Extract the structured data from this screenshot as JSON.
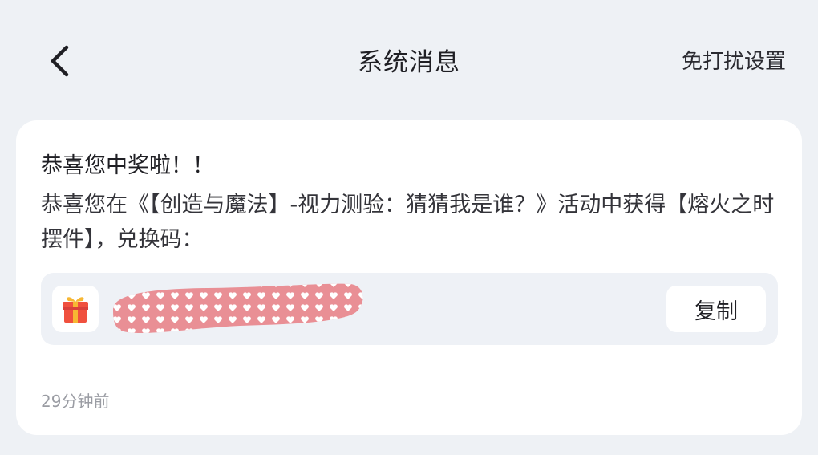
{
  "header": {
    "title": "系统消息",
    "dnd_settings_label": "免打扰设置"
  },
  "message": {
    "title": "恭喜您中奖啦！！",
    "body": "恭喜您在《【创造与魔法】-视力测验：猜猜我是谁？》活动中获得【熔火之时摆件】，兑换码：",
    "copy_label": "复制",
    "timestamp": "29分钟前"
  },
  "colors": {
    "background": "#eef1f5",
    "card": "#ffffff",
    "code_box": "#eef1f6",
    "redaction": "#e98f95",
    "gift_red": "#f0503e",
    "gift_gold": "#f7b733"
  },
  "icons": {
    "back": "chevron-left-icon",
    "gift": "gift-icon"
  }
}
